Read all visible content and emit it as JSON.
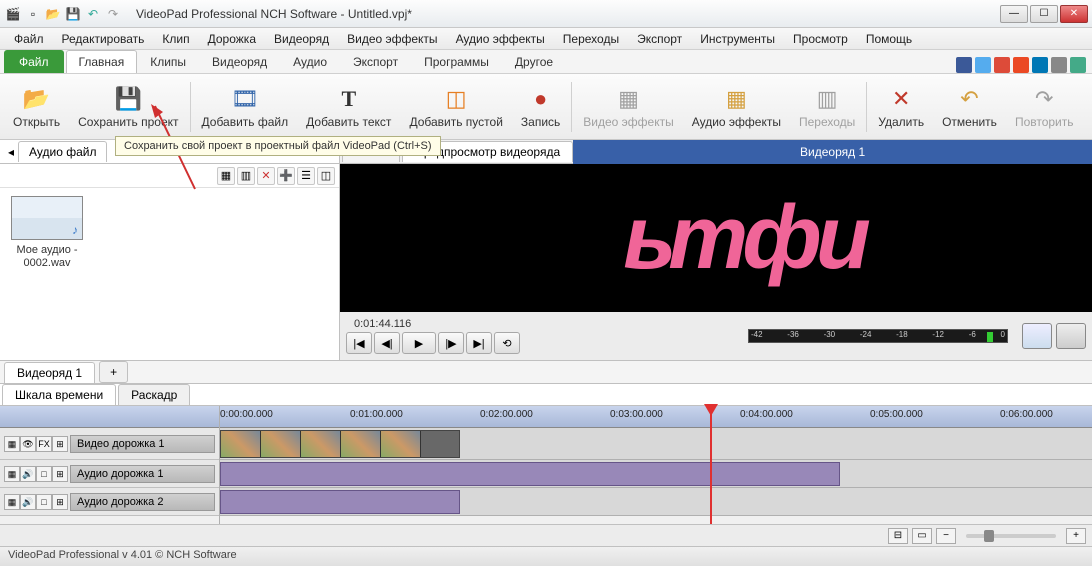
{
  "titlebar": {
    "title": "VideoPad Professional NCH Software - Untitled.vpj*"
  },
  "menu": [
    "Файл",
    "Редактировать",
    "Клип",
    "Дорожка",
    "Видеоряд",
    "Видео эффекты",
    "Аудио эффекты",
    "Переходы",
    "Экспорт",
    "Инструменты",
    "Просмотр",
    "Помощь"
  ],
  "ribbon_tabs": {
    "file": "Файл",
    "items": [
      "Главная",
      "Клипы",
      "Видеоряд",
      "Аудио",
      "Экспорт",
      "Программы",
      "Другое"
    ],
    "active": 0
  },
  "ribbon_buttons": [
    {
      "label": "Открыть",
      "icon": "📂"
    },
    {
      "label": "Сохранить проект",
      "icon": "💾"
    },
    {
      "label": "Добавить файл",
      "icon": "🎞"
    },
    {
      "label": "Добавить текст",
      "icon": "T"
    },
    {
      "label": "Добавить пустой",
      "icon": "▧"
    },
    {
      "label": "Запись",
      "icon": "●"
    },
    {
      "label": "Видео эффекты",
      "icon": "fx",
      "disabled": true
    },
    {
      "label": "Аудио эффекты",
      "icon": "fx"
    },
    {
      "label": "Переходы",
      "icon": "▤",
      "disabled": true
    },
    {
      "label": "Удалить",
      "icon": "✕"
    },
    {
      "label": "Отменить",
      "icon": "↶"
    },
    {
      "label": "Повторить",
      "icon": "↷",
      "disabled": true
    }
  ],
  "tooltip": "Сохранить свой проект в проектный файл VideoPad (Ctrl+S)",
  "left_tabs": {
    "visible": "Аудио файл",
    "extra": "клипа"
  },
  "clip": {
    "name": "Мое аудио - 0002.wav"
  },
  "preview_tabs": {
    "active": "Предпросмотр видеоряда",
    "seq": "Видеоряд 1"
  },
  "preview_text": "ьтфи",
  "timecode": "0:01:44.116",
  "meter_ticks": [
    "-42",
    "-36",
    "-30",
    "-24",
    "-18",
    "-12",
    "-6",
    "0"
  ],
  "timeline": {
    "seq_tab": "Видеоряд 1",
    "view_tabs": [
      "Шкала времени",
      "Раскадр"
    ],
    "ruler": [
      "0:00:00.000",
      "0:01:00.000",
      "0:02:00.000",
      "0:03:00.000",
      "0:04:00.000",
      "0:05:00.000",
      "0:06:00.000"
    ],
    "video_track": "Видео дорожка 1",
    "audio_track1": "Аудио дорожка 1",
    "audio_track2": "Аудио дорожка 2"
  },
  "status": "VideoPad Professional v 4.01 © NCH Software"
}
